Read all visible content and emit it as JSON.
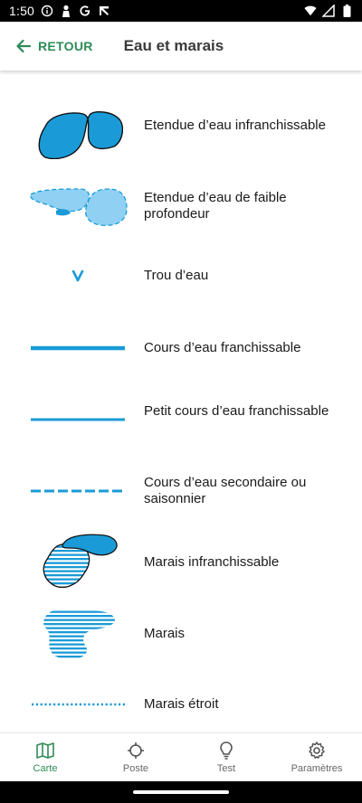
{
  "status_bar": {
    "time": "1:50",
    "left_icons": [
      "info-circle-icon",
      "person-icon",
      "google-icon",
      "cast-icon"
    ],
    "right_icons": [
      "wifi-icon",
      "signal-icon",
      "battery-icon"
    ]
  },
  "app_bar": {
    "back_label": "RETOUR",
    "title": "Eau et marais"
  },
  "legend": {
    "items": [
      {
        "label": "Etendue d’eau infranchissable",
        "symbol": "water-body-impassable-symbol"
      },
      {
        "label": "Etendue d’eau de faible profondeur",
        "symbol": "shallow-water-symbol"
      },
      {
        "label": "Trou d’eau",
        "symbol": "water-hole-symbol"
      },
      {
        "label": "Cours d’eau franchissable",
        "symbol": "crossable-watercourse-symbol"
      },
      {
        "label": "Petit cours d’eau franchissable",
        "symbol": "small-crossable-watercourse-symbol"
      },
      {
        "label": "Cours d’eau secondaire ou saisonnier",
        "symbol": "seasonal-watercourse-symbol"
      },
      {
        "label": "Marais infranchissable",
        "symbol": "impassable-marsh-symbol"
      },
      {
        "label": "Marais",
        "symbol": "marsh-symbol"
      },
      {
        "label": "Marais étroit",
        "symbol": "narrow-marsh-symbol"
      }
    ]
  },
  "bottom_nav": {
    "items": [
      {
        "label": "Carte",
        "icon": "map-icon",
        "active": true
      },
      {
        "label": "Poste",
        "icon": "crosshair-icon",
        "active": false
      },
      {
        "label": "Test",
        "icon": "lightbulb-icon",
        "active": false
      },
      {
        "label": "Paramètres",
        "icon": "gear-icon",
        "active": false
      }
    ]
  },
  "colors": {
    "accent": "#2e8b57",
    "water_dark": "#1a9bd7",
    "water_light": "#8fd0f3",
    "outline": "#111111"
  }
}
